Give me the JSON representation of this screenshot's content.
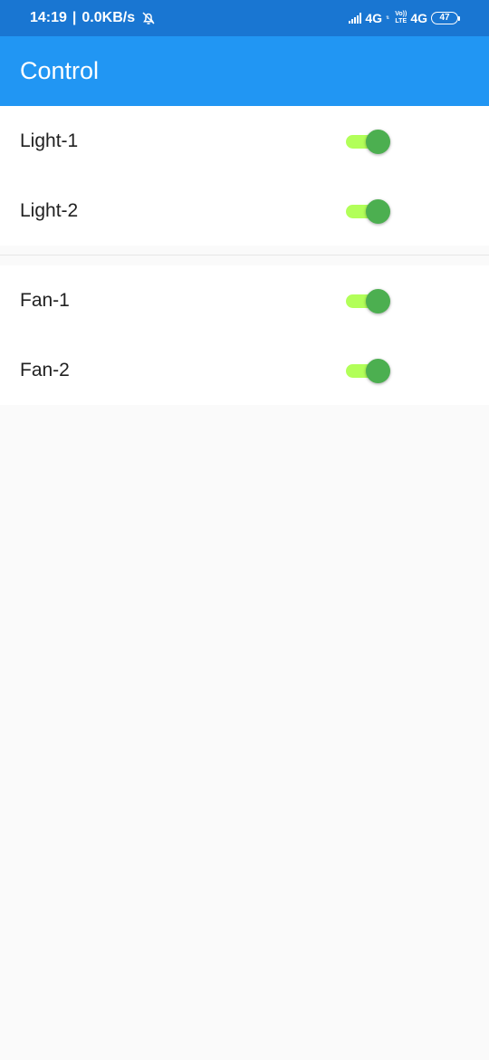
{
  "status_bar": {
    "time": "14:19",
    "separator": "|",
    "speed": "0.0KB/s",
    "net1": "4G",
    "volte_top": "Vo))",
    "volte_bottom": "LTE",
    "net2": "4G",
    "battery": "47"
  },
  "app_bar": {
    "title": "Control"
  },
  "colors": {
    "status_bar": "#1976d2",
    "app_bar": "#2196f3",
    "toggle_track_on": "#b2ff59",
    "toggle_thumb_on": "#4caf50"
  },
  "groups": [
    {
      "items": [
        {
          "label": "Light-1",
          "on": true
        },
        {
          "label": "Light-2",
          "on": true
        }
      ]
    },
    {
      "items": [
        {
          "label": "Fan-1",
          "on": true
        },
        {
          "label": "Fan-2",
          "on": true
        }
      ]
    }
  ]
}
